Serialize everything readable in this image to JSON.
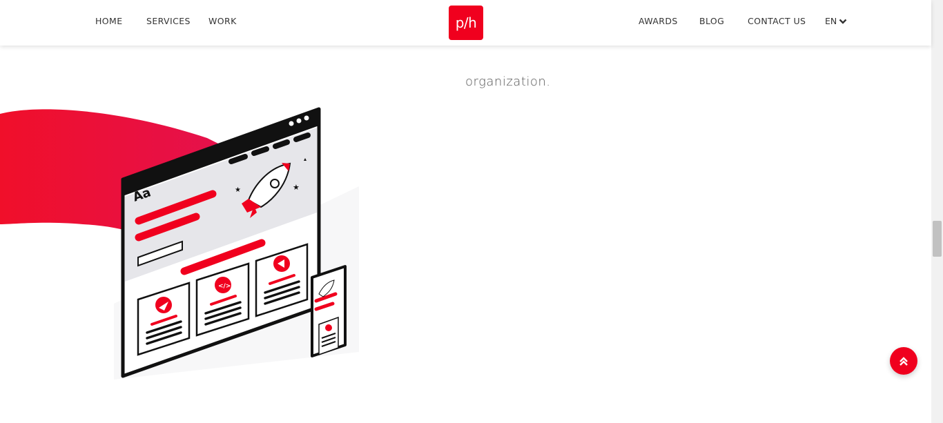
{
  "colors": {
    "accent": "#f0001e",
    "accent_dark": "#e8002d"
  },
  "nav": {
    "left": [
      "HOME",
      "SERVICES",
      "WORK"
    ],
    "right": [
      "AWARDS",
      "BLOG",
      "CONTACT US"
    ],
    "lang": "EN",
    "logo_text": "p/h"
  },
  "content": {
    "text": "organization."
  },
  "illustration": {
    "heading": "Aa"
  },
  "icons": {
    "lang_chevron": "chevron-down-icon",
    "scroll_top": "double-chevron-up-icon"
  }
}
